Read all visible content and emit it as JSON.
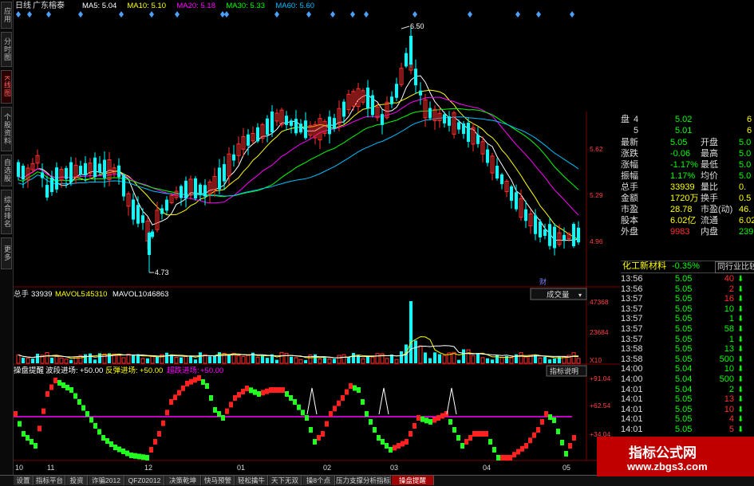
{
  "sidebar": {
    "items": [
      {
        "label": "应用"
      },
      {
        "label": "分时图"
      },
      {
        "label": "K线图"
      },
      {
        "label": "个股资料"
      },
      {
        "label": "自选股"
      },
      {
        "label": "综合排名"
      },
      {
        "label": "更多"
      }
    ]
  },
  "kline": {
    "period": "日线",
    "stock_name": "广东榕泰",
    "ma": [
      {
        "label": "MA5: 5.04",
        "color": "#ffffff"
      },
      {
        "label": "MA10: 5.10",
        "color": "#ffff00"
      },
      {
        "label": "MA20: 5.18",
        "color": "#ff00ff"
      },
      {
        "label": "MA30: 5.33",
        "color": "#00ff00"
      },
      {
        "label": "MA60: 5.60",
        "color": "#00bfff"
      }
    ],
    "price_labels": [
      "5.62",
      "5.29",
      "4.96"
    ],
    "high_label": "6.50",
    "low_label": "4.73",
    "cai_label": "财"
  },
  "volume": {
    "title": "总手",
    "value": "33939",
    "mavol5_label": "MAVOL5:",
    "mavol5": "45310",
    "mavol10_label": "MAVOL10:",
    "mavol10": "46863",
    "select_label": "成交量",
    "axis_labels": [
      "47368",
      "23684",
      "X10"
    ]
  },
  "indicator": {
    "name": "操盘提醒",
    "p1_label": "波段进场:",
    "p1_value": "+50.00",
    "p2_label": "反弹进场:",
    "p2_value": "+50.00",
    "p3_label": "超跌进场:",
    "p3_value": "+50.00",
    "explain_button": "指标说明",
    "axis_labels": [
      "+91.04",
      "+62.54",
      "+34.04"
    ]
  },
  "x_axis_labels": [
    "10",
    "11",
    "12",
    "01",
    "02",
    "03",
    "04",
    "05"
  ],
  "quote": {
    "bids": [
      {
        "label": "盘",
        "level": "4",
        "price": "5.02",
        "right": "6"
      },
      {
        "label": "",
        "level": "5",
        "price": "5.01",
        "right": "6"
      }
    ],
    "stats": [
      {
        "l1": "最新",
        "v1": "5.05",
        "c1": "#00ff00",
        "l2": "开盘",
        "v2": "5.0",
        "c2": "#00ff00"
      },
      {
        "l1": "涨跌",
        "v1": "-0.06",
        "c1": "#00ff00",
        "l2": "最高",
        "v2": "5.0",
        "c2": "#00ff00"
      },
      {
        "l1": "涨幅",
        "v1": "-1.17%",
        "c1": "#00ff00",
        "l2": "最低",
        "v2": "5.0",
        "c2": "#00ff00"
      },
      {
        "l1": "振幅",
        "v1": "1.17%",
        "c1": "#00ff00",
        "l2": "均价",
        "v2": "5.0",
        "c2": "#00ff00"
      },
      {
        "l1": "总手",
        "v1": "33939",
        "c1": "#ffff00",
        "l2": "量比",
        "v2": "0.",
        "c2": "#ffff00"
      },
      {
        "l1": "金额",
        "v1": "1720万",
        "c1": "#ffff00",
        "l2": "换手",
        "v2": "0.5",
        "c2": "#ffff00"
      },
      {
        "l1": "市盈",
        "v1": "28.78",
        "c1": "#ffff00",
        "l2": "市盈(动)",
        "v2": "46.",
        "c2": "#ffff00"
      },
      {
        "l1": "股本",
        "v1": "6.02亿",
        "c1": "#ffff00",
        "l2": "流通",
        "v2": "6.02",
        "c2": "#ffff00"
      },
      {
        "l1": "外盘",
        "v1": "9983",
        "c1": "#ff3030",
        "l2": "内盘",
        "v2": "239",
        "c2": "#00ff00"
      }
    ],
    "sector": {
      "name": "化工新材料",
      "change": "-0.35%",
      "button": "同行业比较"
    },
    "ticks": [
      {
        "time": "13:56",
        "price": "5.05",
        "vol": "40",
        "dir": "down",
        "color": "#ff3030"
      },
      {
        "time": "13:56",
        "price": "5.05",
        "vol": "2",
        "dir": "down",
        "color": "#ff3030"
      },
      {
        "time": "13:57",
        "price": "5.05",
        "vol": "16",
        "dir": "down",
        "color": "#ff3030"
      },
      {
        "time": "13:57",
        "price": "5.05",
        "vol": "10",
        "dir": "down",
        "color": "#00ff00"
      },
      {
        "time": "13:57",
        "price": "5.05",
        "vol": "1",
        "dir": "down",
        "color": "#00ff00"
      },
      {
        "time": "13:57",
        "price": "5.05",
        "vol": "58",
        "dir": "down",
        "color": "#00ff00"
      },
      {
        "time": "13:57",
        "price": "5.05",
        "vol": "1",
        "dir": "down",
        "color": "#00ff00"
      },
      {
        "time": "13:58",
        "price": "5.05",
        "vol": "13",
        "dir": "down",
        "color": "#00ff00"
      },
      {
        "time": "13:58",
        "price": "5.05",
        "vol": "500",
        "dir": "down",
        "color": "#00ff00"
      },
      {
        "time": "14:00",
        "price": "5.04",
        "vol": "10",
        "dir": "down",
        "color": "#00ff00"
      },
      {
        "time": "14:00",
        "price": "5.04",
        "vol": "500",
        "dir": "down",
        "color": "#00ff00"
      },
      {
        "time": "14:01",
        "price": "5.04",
        "vol": "2",
        "dir": "down",
        "color": "#00ff00"
      },
      {
        "time": "14:01",
        "price": "5.05",
        "vol": "13",
        "dir": "down",
        "color": "#ff3030"
      },
      {
        "time": "14:01",
        "price": "5.05",
        "vol": "10",
        "dir": "down",
        "color": "#ff3030"
      },
      {
        "time": "14:01",
        "price": "5.05",
        "vol": "4",
        "dir": "down",
        "color": "#ff3030"
      },
      {
        "time": "14:01",
        "price": "5.05",
        "vol": "5",
        "dir": "down",
        "color": "#ff3030"
      }
    ]
  },
  "tabs": [
    {
      "label": "设置"
    },
    {
      "label": "指标平台"
    },
    {
      "label": "投资"
    },
    {
      "label": "诈骗2012"
    },
    {
      "label": "QFZ02012"
    },
    {
      "label": "决策乾坤"
    },
    {
      "label": "快马预警"
    },
    {
      "label": "轻松擒牛"
    },
    {
      "label": "天下无双"
    },
    {
      "label": "操8个点"
    },
    {
      "label": "压力支撑分析指标"
    },
    {
      "label": "操盘提醒"
    }
  ],
  "watermark": {
    "line1": "指标公式网",
    "line2": "www.zbgs3.com"
  },
  "colors": {
    "up": "#ff3030",
    "down": "#00ffff",
    "ind_up": "#ff2020",
    "ind_down": "#20ff20",
    "ind_mid": "#ff00ff"
  }
}
